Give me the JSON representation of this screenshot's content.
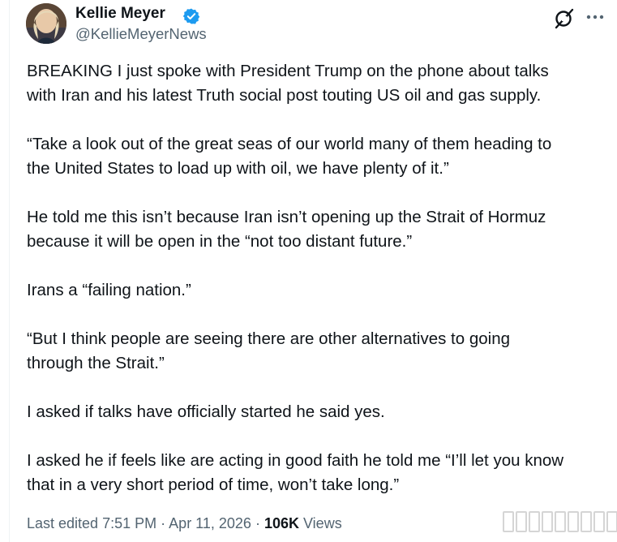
{
  "author": {
    "name": "Kellie Meyer",
    "handle": "@KellieMeyerNews",
    "verified_color": "#1d9bf0"
  },
  "actions": {
    "grok_icon": "grok-icon",
    "more_icon": "more-icon"
  },
  "post": {
    "paragraphs": [
      "BREAKING I just spoke with President Trump on the phone about talks\nwith Iran and his latest Truth social post touting US oil and gas supply.",
      "“Take a look out of the great seas of our world many of them heading to\nthe United States to load up with oil, we have plenty of it.”",
      "He told me this isn’t because Iran isn’t opening up the Strait of Hormuz\nbecause it will be open in the “not too distant future.”",
      "Irans a “failing nation.”",
      "“But I think people are seeing there are other alternatives to going\nthrough the Strait.”",
      "I asked if talks have officially started he said yes.",
      "I asked he if feels like are acting in good faith he told me “I’ll let you know\nthat in a very short period of time, won’t take long.”"
    ]
  },
  "meta": {
    "edited_label": "Last edited",
    "time": "7:51 PM",
    "separator": "·",
    "date": "Apr 11, 2026",
    "views_count": "106K",
    "views_label": "Views"
  }
}
